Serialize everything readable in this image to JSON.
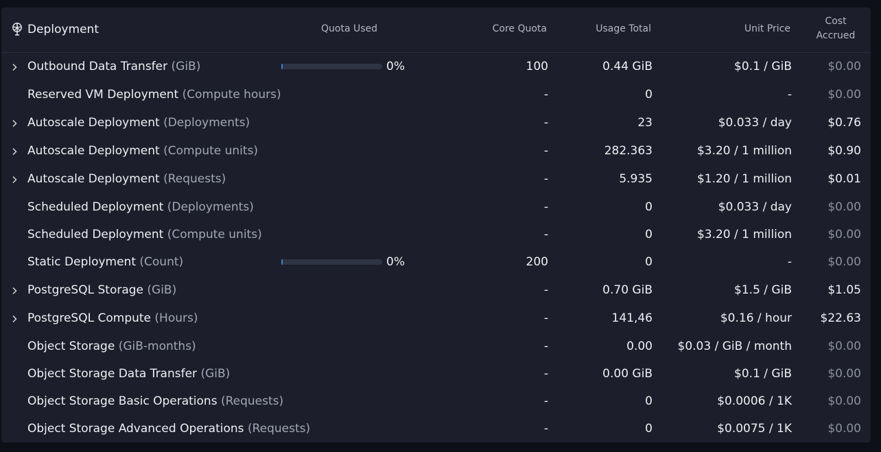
{
  "header": {
    "title": "Deployment",
    "quota_used": "Quota Used",
    "core_quota": "Core Quota",
    "usage_total": "Usage Total",
    "unit_price": "Unit Price",
    "cost_accrued_line1": "Cost",
    "cost_accrued_line2": "Accrued"
  },
  "rows": [
    {
      "name": "Outbound Data Transfer",
      "unit": "(GiB)",
      "expandable": true,
      "quota_percent": "0%",
      "core_quota": "100",
      "usage": "0.44 GiB",
      "price": "$0.1 / GiB",
      "cost": "$0.00",
      "zero": true
    },
    {
      "name": "Reserved VM Deployment",
      "unit": "(Compute hours)",
      "expandable": false,
      "quota_percent": "",
      "core_quota": "-",
      "usage": "0",
      "price": "-",
      "cost": "$0.00",
      "zero": true
    },
    {
      "name": "Autoscale Deployment",
      "unit": "(Deployments)",
      "expandable": true,
      "quota_percent": "",
      "core_quota": "-",
      "usage": "23",
      "price": "$0.033 / day",
      "cost": "$0.76",
      "zero": false
    },
    {
      "name": "Autoscale Deployment",
      "unit": "(Compute units)",
      "expandable": true,
      "quota_percent": "",
      "core_quota": "-",
      "usage": "282.363",
      "price": "$3.20 / 1 million",
      "cost": "$0.90",
      "zero": false
    },
    {
      "name": "Autoscale Deployment",
      "unit": "(Requests)",
      "expandable": true,
      "quota_percent": "",
      "core_quota": "-",
      "usage": "5.935",
      "price": "$1.20 / 1 million",
      "cost": "$0.01",
      "zero": false
    },
    {
      "name": "Scheduled Deployment",
      "unit": "(Deployments)",
      "expandable": false,
      "quota_percent": "",
      "core_quota": "-",
      "usage": "0",
      "price": "$0.033 / day",
      "cost": "$0.00",
      "zero": true
    },
    {
      "name": "Scheduled Deployment",
      "unit": "(Compute units)",
      "expandable": false,
      "quota_percent": "",
      "core_quota": "-",
      "usage": "0",
      "price": "$3.20 / 1 million",
      "cost": "$0.00",
      "zero": true
    },
    {
      "name": "Static Deployment",
      "unit": "(Count)",
      "expandable": false,
      "quota_percent": "0%",
      "core_quota": "200",
      "usage": "0",
      "price": "-",
      "cost": "$0.00",
      "zero": true
    },
    {
      "name": "PostgreSQL Storage",
      "unit": "(GiB)",
      "expandable": true,
      "quota_percent": "",
      "core_quota": "-",
      "usage": "0.70 GiB",
      "price": "$1.5 / GiB",
      "cost": "$1.05",
      "zero": false
    },
    {
      "name": "PostgreSQL Compute",
      "unit": "(Hours)",
      "expandable": true,
      "quota_percent": "",
      "core_quota": "-",
      "usage": "141,46",
      "price": "$0.16 / hour",
      "cost": "$22.63",
      "zero": false
    },
    {
      "name": "Object Storage",
      "unit": "(GiB-months)",
      "expandable": false,
      "quota_percent": "",
      "core_quota": "-",
      "usage": "0.00",
      "price": "$0.03 / GiB / month",
      "cost": "$0.00",
      "zero": true
    },
    {
      "name": "Object Storage Data Transfer",
      "unit": "(GiB)",
      "expandable": false,
      "quota_percent": "",
      "core_quota": "-",
      "usage": "0.00 GiB",
      "price": "$0.1 / GiB",
      "cost": "$0.00",
      "zero": true
    },
    {
      "name": "Object Storage Basic Operations",
      "unit": "(Requests)",
      "expandable": false,
      "quota_percent": "",
      "core_quota": "-",
      "usage": "0",
      "price": "$0.0006 / 1K",
      "cost": "$0.00",
      "zero": true
    },
    {
      "name": "Object Storage Advanced Operations",
      "unit": "(Requests)",
      "expandable": false,
      "quota_percent": "",
      "core_quota": "-",
      "usage": "0",
      "price": "$0.0075 / 1K",
      "cost": "$0.00",
      "zero": true
    }
  ],
  "icons": {
    "title": "deployment-icon",
    "expand": "chevron-right-icon"
  },
  "colors": {
    "background": "#0e1018",
    "panel": "#1c1f2b",
    "text": "#eef0f4",
    "muted": "#a3a7b4",
    "bar_track": "#2f3445",
    "bar_fill": "#3b82c4"
  }
}
